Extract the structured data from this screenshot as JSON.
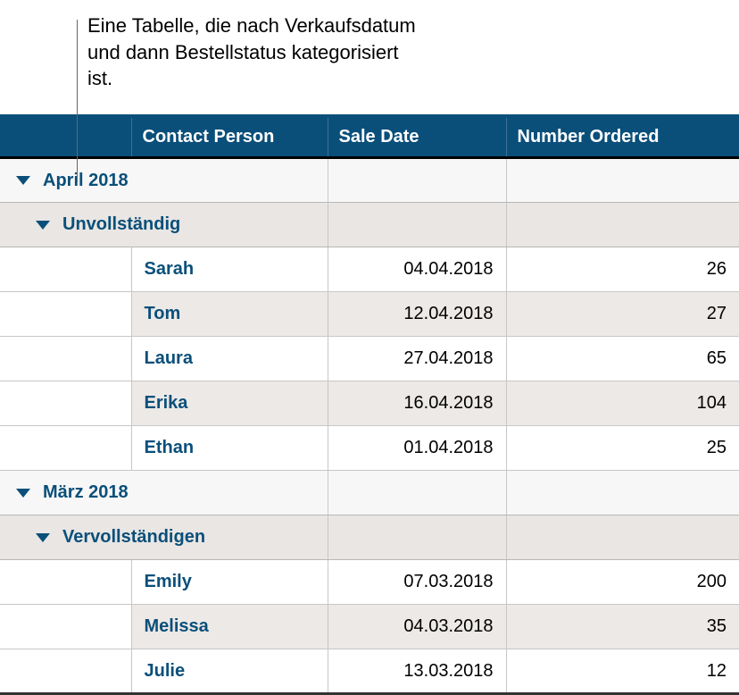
{
  "callout": "Eine Tabelle, die nach Verkaufsdatum und dann Bestellstatus kategorisiert ist.",
  "columns": {
    "contact": "Contact Person",
    "date": "Sale Date",
    "number": "Number Ordered"
  },
  "groups": [
    {
      "label": "April 2018",
      "subgroups": [
        {
          "label": "Unvollständig",
          "rows": [
            {
              "contact": "Sarah",
              "date": "04.04.2018",
              "number": "26"
            },
            {
              "contact": "Tom",
              "date": "12.04.2018",
              "number": "27"
            },
            {
              "contact": "Laura",
              "date": "27.04.2018",
              "number": "65"
            },
            {
              "contact": "Erika",
              "date": "16.04.2018",
              "number": "104"
            },
            {
              "contact": "Ethan",
              "date": "01.04.2018",
              "number": "25"
            }
          ]
        }
      ]
    },
    {
      "label": "März 2018",
      "subgroups": [
        {
          "label": "Vervollständigen",
          "rows": [
            {
              "contact": "Emily",
              "date": "07.03.2018",
              "number": "200"
            },
            {
              "contact": "Melissa",
              "date": "04.03.2018",
              "number": "35"
            },
            {
              "contact": "Julie",
              "date": "13.03.2018",
              "number": "12"
            }
          ]
        }
      ]
    }
  ]
}
